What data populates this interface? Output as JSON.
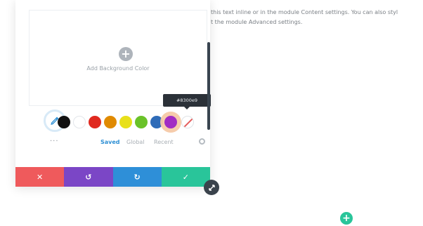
{
  "background_text": {
    "line1": "this text inline or in the module Content settings. You can also styl",
    "line2": "t the module Advanced settings."
  },
  "background_area": {
    "label": "Add Background Color",
    "icon": "plus-circle-icon"
  },
  "tooltip": {
    "text": "#8300e9"
  },
  "palette": {
    "swatches": [
      {
        "name": "black",
        "color": "#111111"
      },
      {
        "name": "white",
        "color": "#ffffff"
      },
      {
        "name": "red",
        "color": "#e0291f"
      },
      {
        "name": "orange",
        "color": "#e08a00"
      },
      {
        "name": "yellow",
        "color": "#e8e01a"
      },
      {
        "name": "green",
        "color": "#6ac229"
      },
      {
        "name": "blue",
        "color": "#2f6cb8"
      },
      {
        "name": "purple",
        "color": "#a12cc4",
        "selected": true
      },
      {
        "name": "none",
        "color": "transparent"
      }
    ],
    "tabs": [
      "Saved",
      "Global",
      "Recent"
    ],
    "active_tab": "Saved",
    "more": "..."
  },
  "actions": {
    "cancel": "✕",
    "undo": "↺",
    "redo": "↻",
    "save": "✓"
  },
  "colors": {
    "accent": "#2d8fd4",
    "cancel": "#ef5a5c",
    "undo": "#7b46c6",
    "redo": "#2e8fd8",
    "save": "#29c59a"
  }
}
